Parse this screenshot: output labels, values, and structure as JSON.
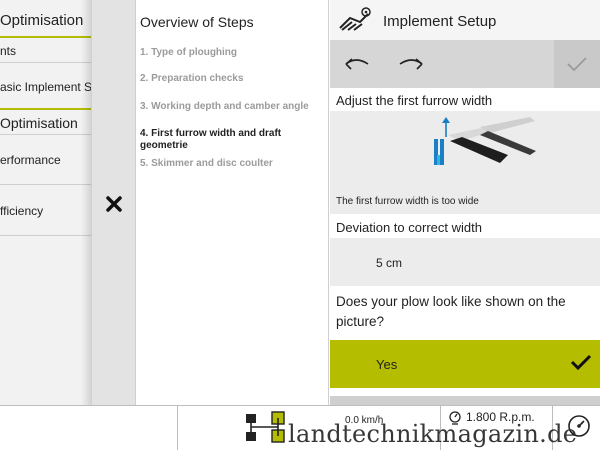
{
  "left_menu": {
    "heading_top": "Optimisation",
    "item_1": "nts",
    "item_2": "asic Implement S",
    "heading_2": "Optimisation",
    "item_3": "erformance",
    "item_4": "fficiency"
  },
  "steps": {
    "title": "Overview of Steps",
    "items": [
      "1. Type of ploughing",
      "2. Preparation checks",
      "3. Working depth and camber angle",
      "4. First furrow width and draft geometrie",
      "5. Skimmer and disc coulter"
    ],
    "active_index": 3
  },
  "panel": {
    "title": "Implement Setup",
    "title_icon": "plough-settings-icon",
    "back_icon": "arrow-left-icon",
    "forward_icon": "arrow-right-icon",
    "confirm_icon": "check-icon",
    "section_1": "Adjust the first furrow width",
    "image_caption": "The first furrow width is too wide",
    "section_2": "Deviation to correct width",
    "deviation_value": "5 cm",
    "question": "Does your plow look like shown on the picture?",
    "yes_label": "Yes",
    "accent_color": "#b5bd00"
  },
  "status_bar": {
    "speed": "0.0 km/h",
    "rpm": "1.800 R.p.m.",
    "watermark": "landtechnikmagazin.de"
  }
}
